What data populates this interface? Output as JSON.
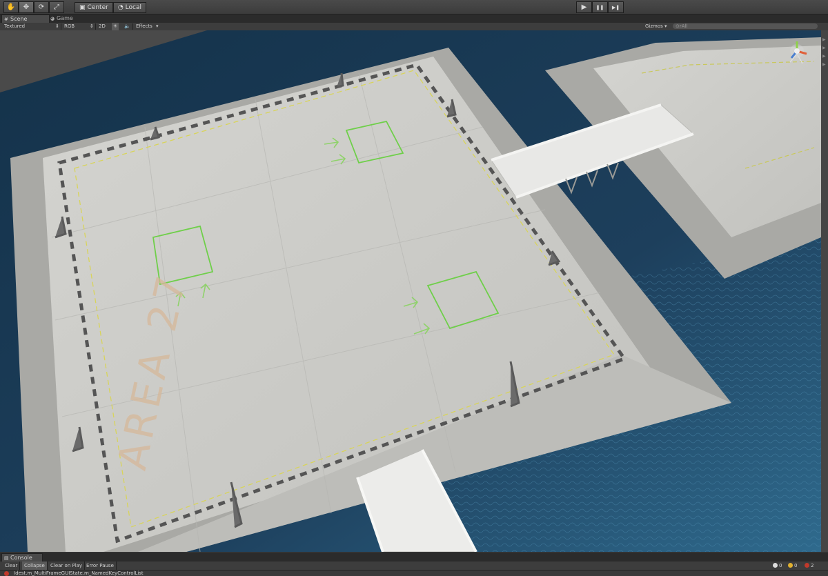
{
  "toolbar": {
    "tools": [
      {
        "name": "hand-tool",
        "icon": "✋"
      },
      {
        "name": "move-tool",
        "icon": "✥"
      },
      {
        "name": "rotate-tool",
        "icon": "⟳"
      },
      {
        "name": "scale-tool",
        "icon": "⤢"
      }
    ],
    "pivot_label": "Center",
    "space_label": "Local",
    "play_controls": [
      {
        "name": "play-button",
        "icon": "▶"
      },
      {
        "name": "pause-button",
        "icon": "❚❚"
      },
      {
        "name": "step-button",
        "icon": "▶❚"
      }
    ]
  },
  "tabs": {
    "scene": "Scene",
    "game": "Game"
  },
  "scene_controls": {
    "render_mode": "Textured",
    "color_mode": "RGB",
    "mode_2d": "2D",
    "effects": "Effects",
    "gizmos": "Gizmos",
    "search_placeholder": "⊙rAll"
  },
  "scene": {
    "ground_text": "AREA 27",
    "water_color": "#1e3a52",
    "platform_color": "#cfcfcb"
  },
  "console": {
    "tab_label": "Console",
    "buttons": [
      "Clear",
      "Collapse",
      "Clear on Play",
      "Error Pause"
    ],
    "active_button": "Collapse",
    "info_count": "0",
    "warning_count": "0",
    "error_count": "2",
    "last_message": "Idest.m_MultiFrameGUIState.m_NamedKeyControlList"
  }
}
